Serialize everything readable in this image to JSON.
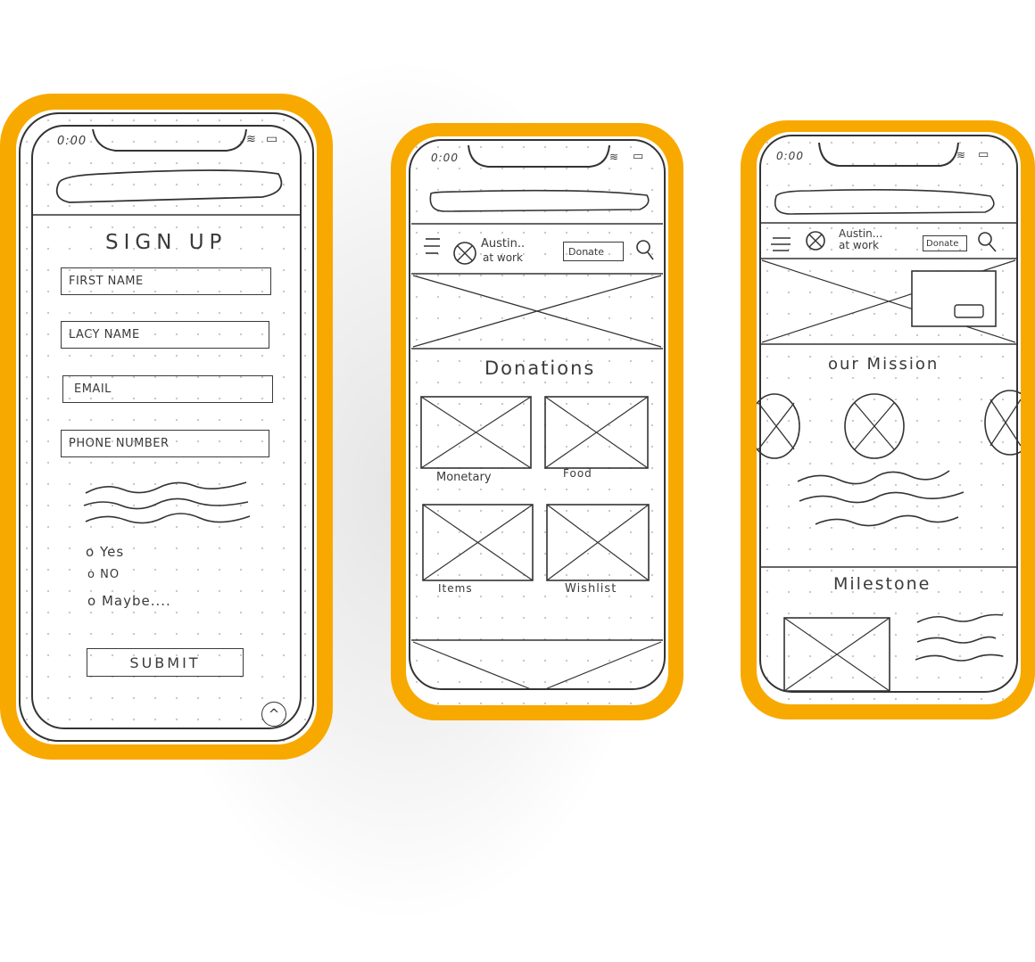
{
  "colors": {
    "frame": "#f8a900",
    "sketch": "#3a3a3a",
    "dots": "#c9c9c9"
  },
  "phone1": {
    "status_time": "0:00",
    "title": "SIGN UP",
    "fields": {
      "first_name": "FIRST NAME",
      "last_name": "LACY NAME",
      "email": "EMAIL",
      "phone": "PHONE NUMBER"
    },
    "options": [
      "Yes",
      "NO",
      "Maybe...."
    ],
    "submit_label": "SUBMIT",
    "scroll_up_icon": "chevron-up-icon"
  },
  "phone2": {
    "status_time": "0:00",
    "brand": "Austin..",
    "brand_sub": "at work",
    "donate_label": "Donate",
    "section_title": "Donations",
    "tiles": [
      "Monetary",
      "Food",
      "Items",
      "Wishlist"
    ]
  },
  "phone3": {
    "status_time": "0:00",
    "brand": "Austin...",
    "brand_sub": "at work",
    "donate_label": "Donate",
    "mission_title": "our Mission",
    "milestone_title": "Milestone"
  }
}
